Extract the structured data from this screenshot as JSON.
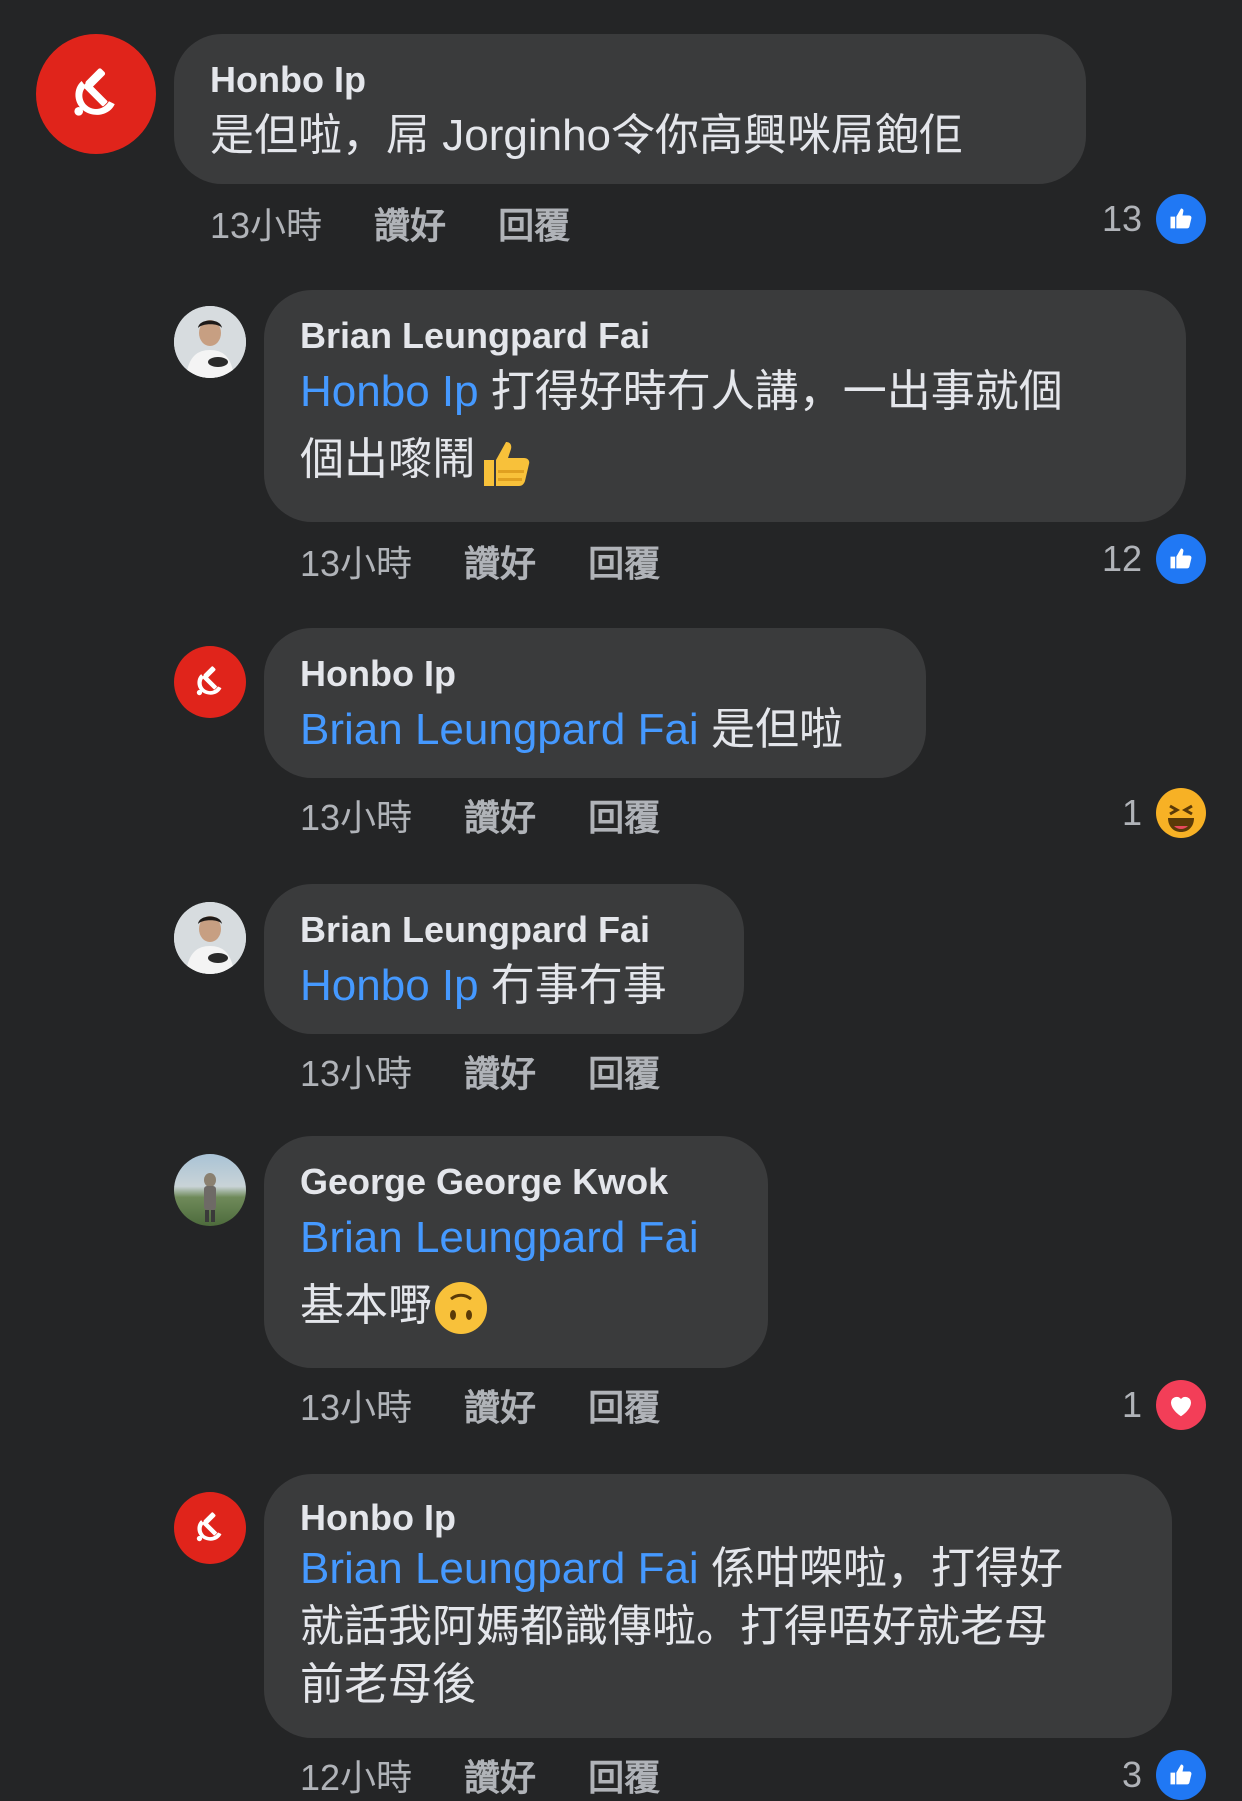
{
  "comments": [
    {
      "author": "Honbo Ip",
      "mention": "",
      "text": "是但啦，屌 Jorginho令你高興咪屌飽佢",
      "time": "13小時",
      "like": "讚好",
      "reply": "回覆",
      "reaction_count": "13",
      "reaction": "like",
      "avatar": "hammer-sickle"
    },
    {
      "author": "Brian Leungpard Fai",
      "mention": "Honbo Ip",
      "text_line1": " 打得好時冇人講，一出事就個",
      "text_line2": "個出嚟鬧",
      "emoji": "thumbs-up",
      "time": "13小時",
      "like": "讚好",
      "reply": "回覆",
      "reaction_count": "12",
      "reaction": "like",
      "avatar": "photo"
    },
    {
      "author": "Honbo Ip",
      "mention": "Brian Leungpard Fai",
      "text": " 是但啦",
      "time": "13小時",
      "like": "讚好",
      "reply": "回覆",
      "reaction_count": "1",
      "reaction": "haha",
      "avatar": "hammer-sickle"
    },
    {
      "author": "Brian Leungpard Fai",
      "mention": "Honbo Ip",
      "text": " 冇事冇事",
      "time": "13小時",
      "like": "讚好",
      "reply": "回覆",
      "avatar": "photo"
    },
    {
      "author": "George George Kwok",
      "mention": "Brian Leungpard Fai",
      "text": "基本嘢",
      "emoji": "upside-down-face",
      "time": "13小時",
      "like": "讚好",
      "reply": "回覆",
      "reaction_count": "1",
      "reaction": "love",
      "avatar": "photo"
    },
    {
      "author": "Honbo Ip",
      "mention": "Brian Leungpard Fai",
      "text_line1": " 係咁㗎啦，打得好",
      "text_line2": "就話我阿媽都識傳啦。打得唔好就老母",
      "text_line3": "前老母後",
      "time": "12小時",
      "like": "讚好",
      "reply": "回覆",
      "reaction_count": "3",
      "reaction": "like",
      "avatar": "hammer-sickle"
    }
  ],
  "colors": {
    "background": "#242526",
    "bubble": "#3a3b3c",
    "mention": "#4599ff",
    "like": "#2078f4",
    "haha": "#f7b125",
    "love": "#f33e58",
    "avatar_red": "#e0241b"
  }
}
